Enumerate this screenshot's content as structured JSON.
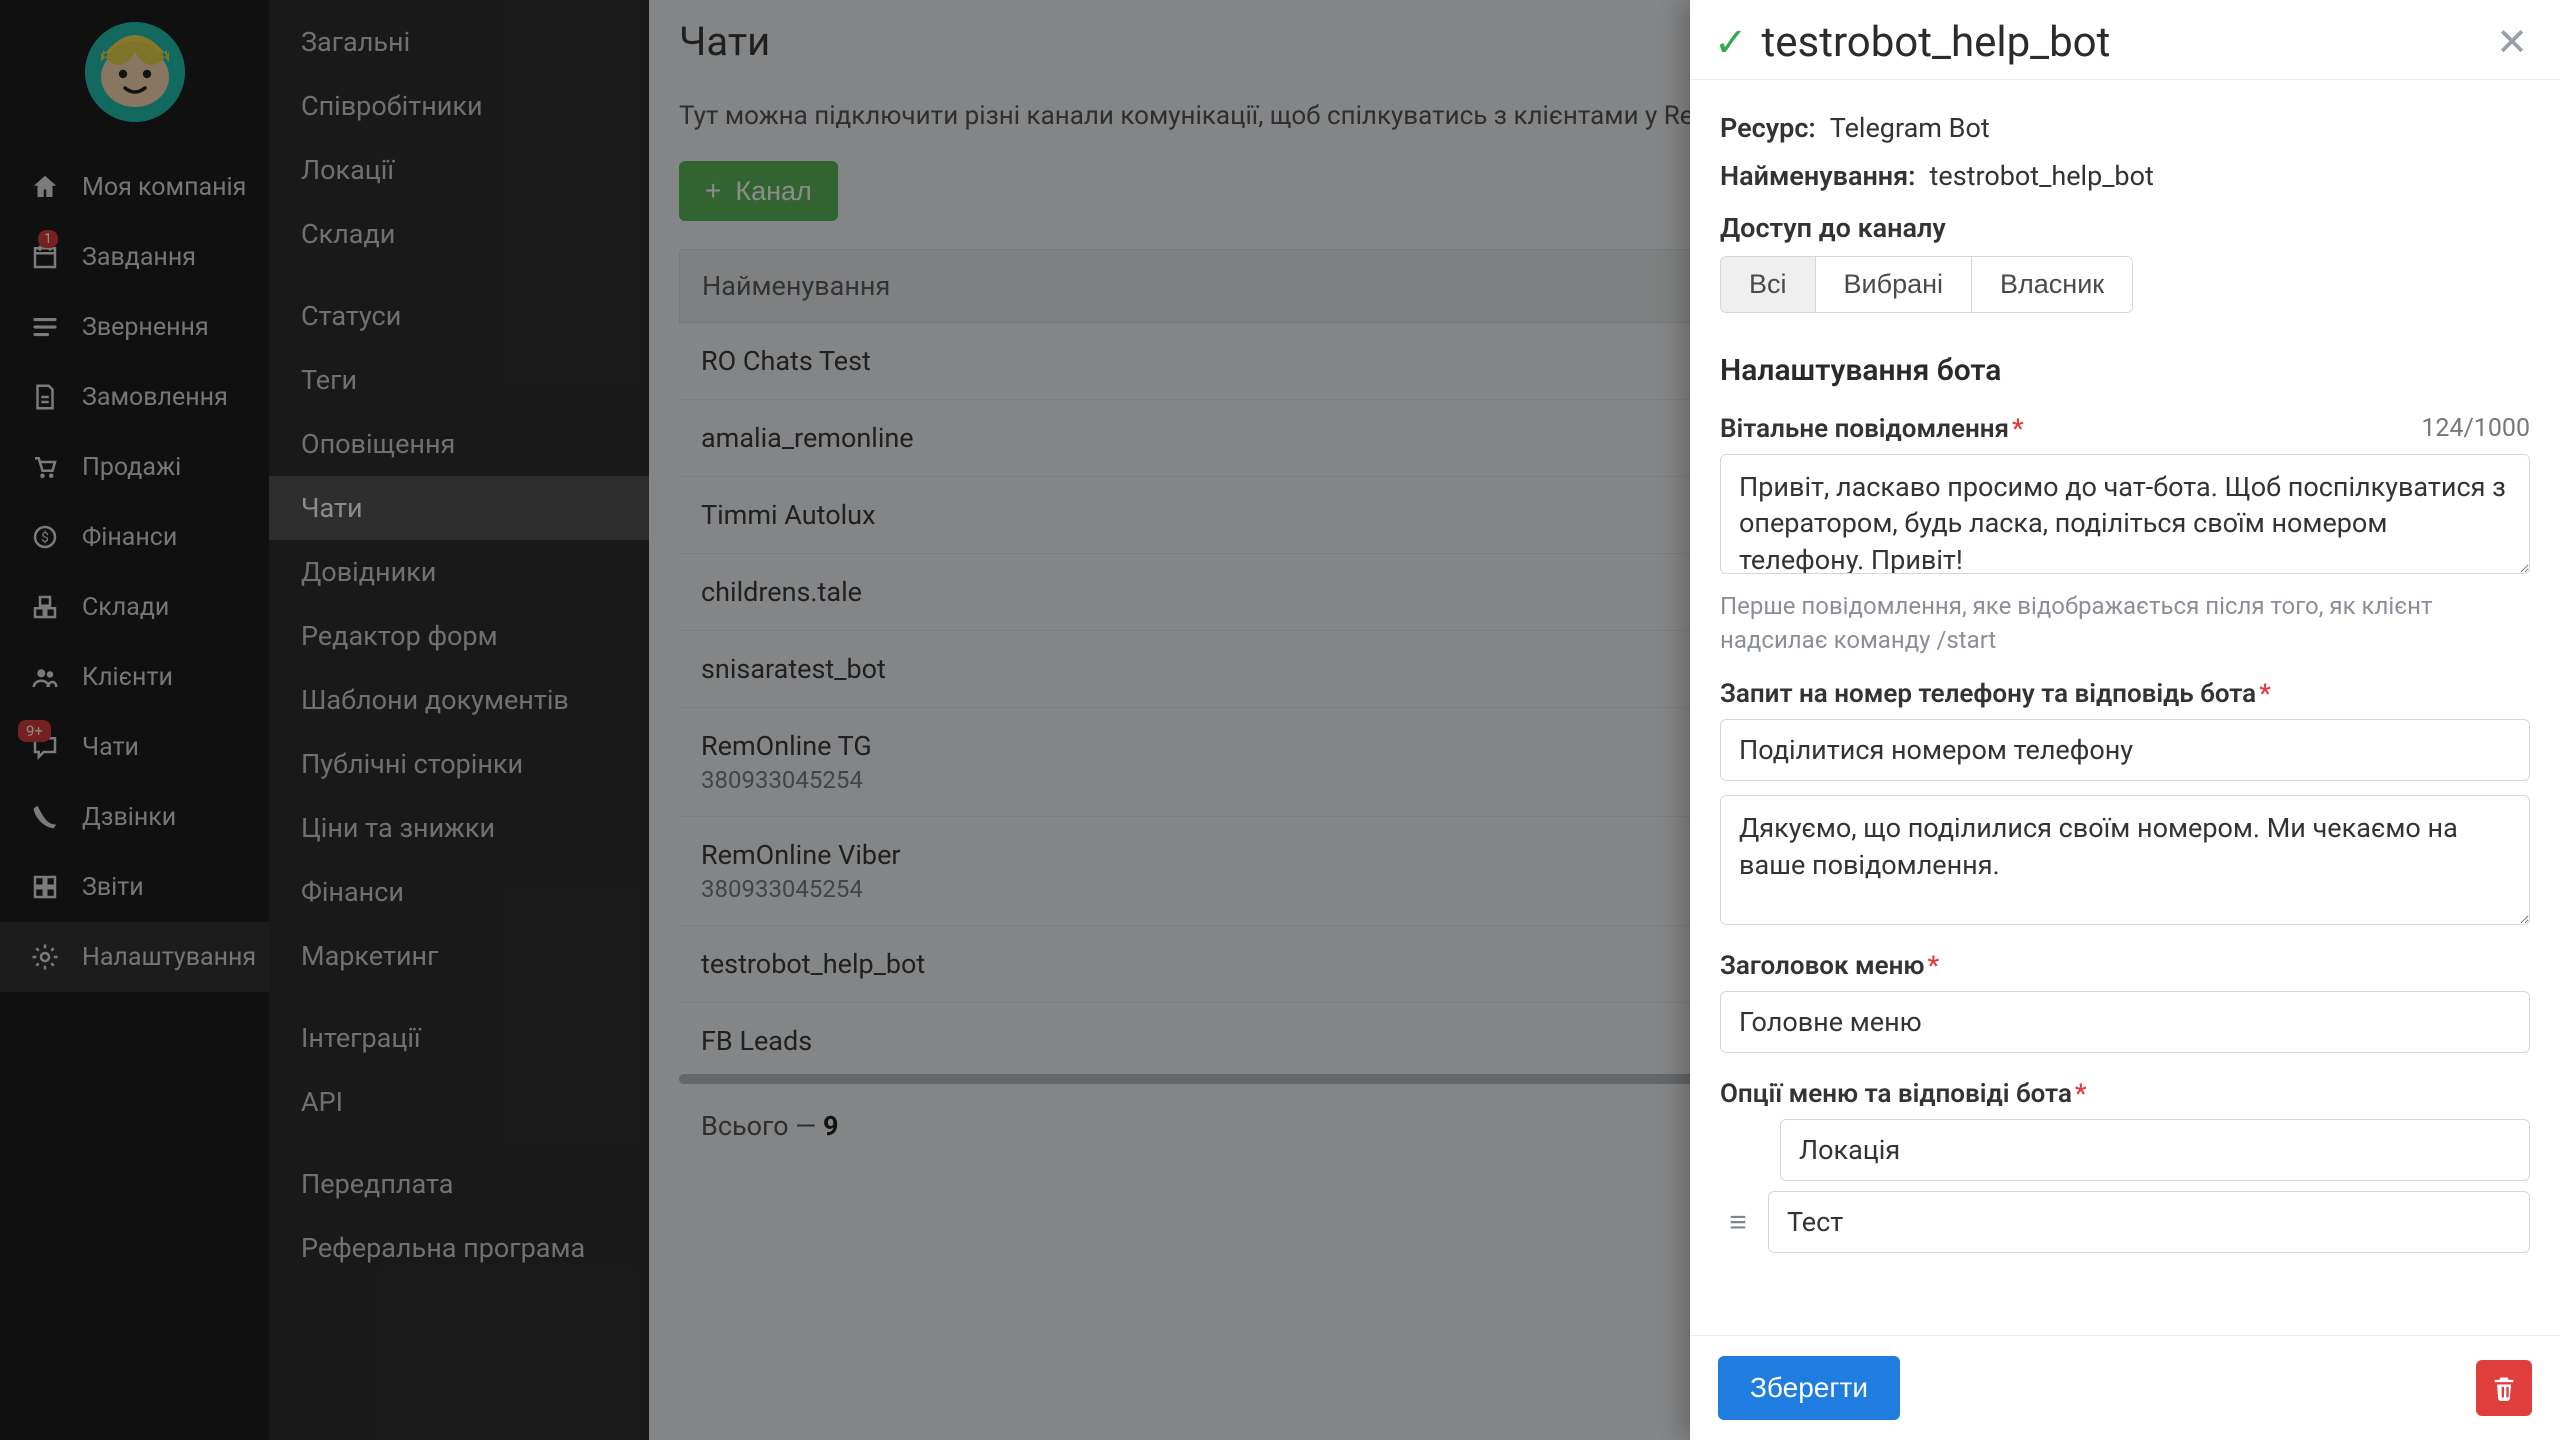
{
  "primary_nav": [
    {
      "name": "company",
      "label": "Моя компанія",
      "icon": "home"
    },
    {
      "name": "tasks",
      "label": "Завдання",
      "icon": "calendar",
      "badge": "1"
    },
    {
      "name": "requests",
      "label": "Звернення",
      "icon": "lines"
    },
    {
      "name": "orders",
      "label": "Замовлення",
      "icon": "doc"
    },
    {
      "name": "sales",
      "label": "Продажі",
      "icon": "cart"
    },
    {
      "name": "finance",
      "label": "Фінанси",
      "icon": "coin"
    },
    {
      "name": "stock",
      "label": "Склади",
      "icon": "boxes"
    },
    {
      "name": "clients",
      "label": "Клієнти",
      "icon": "users"
    },
    {
      "name": "chats",
      "label": "Чати",
      "icon": "chat",
      "badge": "9+"
    },
    {
      "name": "calls",
      "label": "Дзвінки",
      "icon": "phone"
    },
    {
      "name": "reports",
      "label": "Звіти",
      "icon": "grid"
    },
    {
      "name": "settings",
      "label": "Налаштування",
      "icon": "gear",
      "active": true
    }
  ],
  "secondary_nav": {
    "group1": [
      "Загальні",
      "Співробітники",
      "Локації",
      "Склади"
    ],
    "group2": [
      "Статуси",
      "Теги",
      "Оповіщення",
      "Чати",
      "Довідники",
      "Редактор форм",
      "Шаблони документів",
      "Публічні сторінки",
      "Ціни та знижки",
      "Фінанси",
      "Маркетинг"
    ],
    "group3": [
      "Інтеграції",
      "API"
    ],
    "group4": [
      "Передплата",
      "Реферальна програма"
    ],
    "active": "Чати"
  },
  "main": {
    "title": "Чати",
    "description": "Тут можна підключити різні канали комунікації, щоб спілкуватись з клієнтами у RemOnline",
    "add_channel_label": "Канал",
    "table_header": "Найменування",
    "rows": [
      {
        "name": "RO Chats Test"
      },
      {
        "name": "amalia_remonline"
      },
      {
        "name": "Timmi Autolux"
      },
      {
        "name": "childrens.tale"
      },
      {
        "name": "snisaratest_bot"
      },
      {
        "name": "RemOnline TG",
        "sub": "380933045254"
      },
      {
        "name": "RemOnline Viber",
        "sub": "380933045254"
      },
      {
        "name": "testrobot_help_bot"
      },
      {
        "name": "FB Leads"
      }
    ],
    "total_label": "Всього —",
    "total_value": "9"
  },
  "drawer": {
    "title": "testrobot_help_bot",
    "resource_key": "Ресурс:",
    "resource_val": "Telegram Bot",
    "name_key": "Найменування:",
    "name_val": "testrobot_help_bot",
    "access_label": "Доступ до каналу",
    "access_options": [
      "Всі",
      "Вибрані",
      "Власник"
    ],
    "access_active": "Всі",
    "bot_settings_heading": "Налаштування бота",
    "welcome_label": "Вітальне повідомлення",
    "welcome_counter": "124/1000",
    "welcome_value": "Привіт, ласкаво просимо до чат-бота. Щоб поспілкуватися з оператором, будь ласка, поділіться своїм номером телефону. Привіт!",
    "welcome_hint": "Перше повідомлення, яке відображається після того, як клієнт надсилає команду /start",
    "phone_label": "Запит на номер телефону та відповідь бота",
    "phone_btn_value": "Поділитися номером телефону",
    "phone_reply_value": "Дякуємо, що поділилися своїм номером. Ми чекаємо на ваше повідомлення.",
    "menu_title_label": "Заголовок меню",
    "menu_title_value": "Головне меню",
    "options_label": "Опції меню та відповіді бота",
    "options": [
      "Локація",
      "Тест"
    ],
    "save_label": "Зберегти"
  }
}
